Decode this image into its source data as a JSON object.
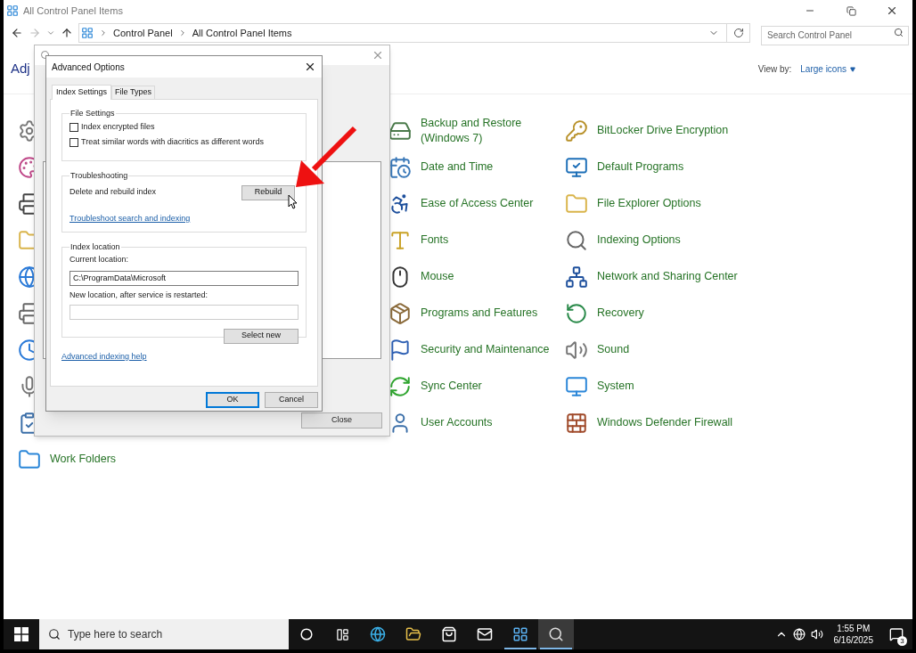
{
  "window": {
    "title": "All Control Panel Items"
  },
  "nav": {
    "back": {
      "disabled": false
    },
    "forward": {
      "disabled": true
    }
  },
  "address_bar": {
    "path": [
      "Control Panel",
      "All Control Panel Items"
    ]
  },
  "search": {
    "placeholder": "Search Control Panel"
  },
  "heading": "Adj",
  "view_by": {
    "label": "View by:",
    "value": "Large icons"
  },
  "items": {
    "left": [
      {
        "label": "Work Folders"
      }
    ],
    "middle": [
      {
        "label": "Backup and Restore (Windows 7)"
      },
      {
        "label": "Date and Time"
      },
      {
        "label": "Ease of Access Center"
      },
      {
        "label": "Fonts"
      },
      {
        "label": "Mouse"
      },
      {
        "label": "Programs and Features"
      },
      {
        "label": "Security and Maintenance"
      },
      {
        "label": "Sync Center"
      },
      {
        "label": "User Accounts"
      }
    ],
    "right": [
      {
        "label": "BitLocker Drive Encryption"
      },
      {
        "label": "Default Programs"
      },
      {
        "label": "File Explorer Options"
      },
      {
        "label": "Indexing Options"
      },
      {
        "label": "Network and Sharing Center"
      },
      {
        "label": "Recovery"
      },
      {
        "label": "Sound"
      },
      {
        "label": "System"
      },
      {
        "label": "Windows Defender Firewall"
      }
    ]
  },
  "indexing_dialog": {
    "close_button": "Close"
  },
  "advanced_dialog": {
    "title": "Advanced Options",
    "tabs": [
      {
        "label": "Index Settings",
        "selected": true
      },
      {
        "label": "File Types",
        "selected": false
      }
    ],
    "file_settings": {
      "title": "File Settings",
      "options": [
        {
          "label": "Index encrypted files",
          "checked": false
        },
        {
          "label": "Treat similar words with diacritics as different words",
          "checked": false
        }
      ]
    },
    "troubleshooting": {
      "title": "Troubleshooting",
      "description": "Delete and rebuild index",
      "button": "Rebuild",
      "link": "Troubleshoot search and indexing"
    },
    "index_location": {
      "title": "Index location",
      "current_label": "Current location:",
      "current_value": "C:\\ProgramData\\Microsoft",
      "new_label": "New location, after service is restarted:",
      "button": "Select new"
    },
    "help_link": "Advanced indexing help",
    "buttons": [
      {
        "label": "OK",
        "default": true
      },
      {
        "label": "Cancel",
        "default": false
      }
    ]
  },
  "taskbar": {
    "search_placeholder": "Type here to search",
    "apps": [
      {
        "running": false,
        "selected": false
      },
      {
        "running": false,
        "selected": false
      },
      {
        "running": false,
        "selected": false
      },
      {
        "running": false,
        "selected": false
      },
      {
        "running": true,
        "selected": false
      },
      {
        "running": true,
        "selected": true
      }
    ],
    "clock": {
      "time": "1:55 PM",
      "date": "6/16/2025"
    },
    "notifications": "3"
  }
}
